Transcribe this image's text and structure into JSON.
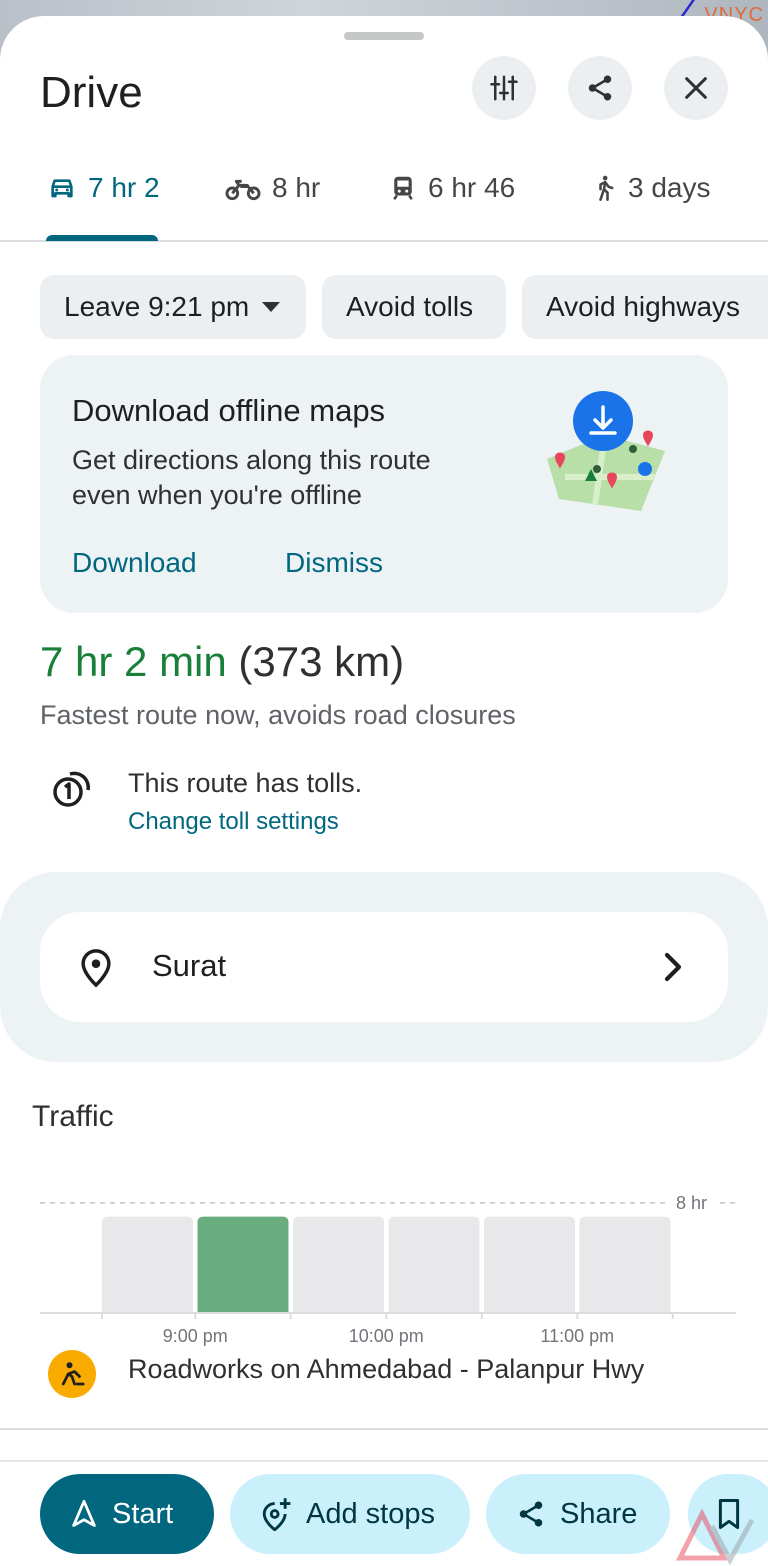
{
  "map": {
    "label": "VNYC"
  },
  "header": {
    "title": "Drive"
  },
  "tabs": [
    {
      "mode": "car-icon",
      "label": "7 hr 2",
      "active": true
    },
    {
      "mode": "motorcycle-icon",
      "label": "8 hr",
      "active": false
    },
    {
      "mode": "transit-icon",
      "label": "6 hr 46",
      "active": false
    },
    {
      "mode": "walk-icon",
      "label": "3 days",
      "active": false
    }
  ],
  "chips": {
    "leave": "Leave 9:21 pm",
    "avoid_tolls": "Avoid tolls",
    "avoid_highways": "Avoid highways"
  },
  "offline_card": {
    "title": "Download offline maps",
    "body": "Get directions along this route even when you're offline",
    "download": "Download",
    "dismiss": "Dismiss"
  },
  "route": {
    "duration": "7 hr 2 min",
    "distance": "(373 km)",
    "description": "Fastest route now, avoids road closures",
    "toll_text": "This route has tolls.",
    "toll_link": "Change toll settings"
  },
  "destination": {
    "name": "Surat"
  },
  "traffic": {
    "title": "Traffic",
    "incident": "Roadworks on Ahmedabad - Palanpur Hwy"
  },
  "chart_data": {
    "type": "bar",
    "categories": [
      "",
      "",
      "",
      "",
      "",
      ""
    ],
    "values": [
      7,
      7,
      7,
      7,
      7,
      7
    ],
    "highlighted_index": 1,
    "ylim": [
      0,
      8.5
    ],
    "reference_line": {
      "value": 8,
      "label": "8 hr"
    },
    "tick_labels": [
      "9:00 pm",
      "10:00 pm",
      "11:00 pm"
    ],
    "colors": {
      "bar": "#e8e8ea",
      "highlight": "#6aae7f"
    }
  },
  "bottom_bar": {
    "start": "Start",
    "add_stops": "Add stops",
    "share": "Share"
  },
  "colors": {
    "accent": "#00677f",
    "time_green": "#188038",
    "pale": "#c9f0fb"
  }
}
